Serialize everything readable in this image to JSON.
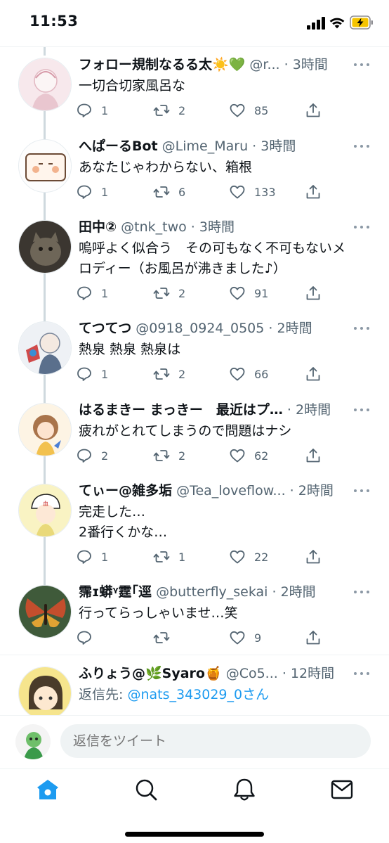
{
  "status_bar": {
    "time": "11:53"
  },
  "tweets": [
    {
      "name": "フォロー規制なるる太☀️💚",
      "handle": "@r...",
      "time": "· 3時間",
      "text_lines": [
        "一切合切家風呂な"
      ],
      "replies": "1",
      "retweets": "2",
      "likes": "85",
      "avatar_colors": [
        "#f7e8ec",
        "#e9c6cf"
      ]
    },
    {
      "name": "へぱーるBot",
      "handle": "@Lime_Maru",
      "time": "· 3時間",
      "text_lines": [
        "あなたじゃわからない、箱根"
      ],
      "replies": "1",
      "retweets": "6",
      "likes": "133",
      "avatar_colors": [
        "#fdfdfd",
        "#f2b38e"
      ]
    },
    {
      "name": "田中②",
      "handle": "@tnk_two",
      "time": "· 3時間",
      "text_lines": [
        "嗚呼よく似合う　その可もなく不可もないメ",
        "ロディー（お風呂が沸きました♪）"
      ],
      "replies": "1",
      "retweets": "2",
      "likes": "91",
      "avatar_colors": [
        "#6e6658",
        "#3b3630"
      ]
    },
    {
      "name": "てつてつ",
      "handle": "@0918_0924_0505",
      "time": "· 2時間",
      "text_lines": [
        "熱泉 熱泉 熱泉は"
      ],
      "replies": "1",
      "retweets": "2",
      "likes": "66",
      "avatar_colors": [
        "#eef1f5",
        "#5a6f8c"
      ]
    },
    {
      "name": "はるまきー まっきー　最近はプ…",
      "handle": "",
      "time": "· 2時間",
      "text_lines": [
        "疲れがとれてしまうので問題はナシ"
      ],
      "replies": "2",
      "retweets": "2",
      "likes": "62",
      "avatar_colors": [
        "#fdf4e4",
        "#a9744b"
      ]
    },
    {
      "name": "てぃー@雑多垢",
      "handle": "@Tea_loveflow...",
      "time": "· 2時間",
      "text_lines": [
        "完走した…",
        "2番行くかな…"
      ],
      "replies": "1",
      "retweets": "1",
      "likes": "22",
      "avatar_colors": [
        "#f9f3c3",
        "#e9d97a"
      ]
    },
    {
      "name": "霈ɪ蟒ᵞ霆｢逕",
      "handle": "@butterfly_sekai",
      "time": "· 2時間",
      "text_lines": [
        "行ってらっしゃいませ…笑"
      ],
      "replies": "",
      "retweets": "",
      "likes": "9",
      "avatar_colors": [
        "#3f5a3a",
        "#c34e2d"
      ]
    },
    {
      "name": "ふりょう@🌿Syaro🍯",
      "handle": "@Co5...",
      "time": "· 12時間",
      "reply_prefix": "返信先:",
      "reply_to": "@nats_343029_0さん",
      "avatar_colors": [
        "#f6e58d",
        "#4a3b2a"
      ]
    }
  ],
  "reply_bar": {
    "placeholder": "返信をツイート"
  },
  "nav": {
    "icons": [
      "home-icon",
      "search-icon",
      "notifications-icon",
      "messages-icon"
    ],
    "accent": "#1d9bf0"
  }
}
